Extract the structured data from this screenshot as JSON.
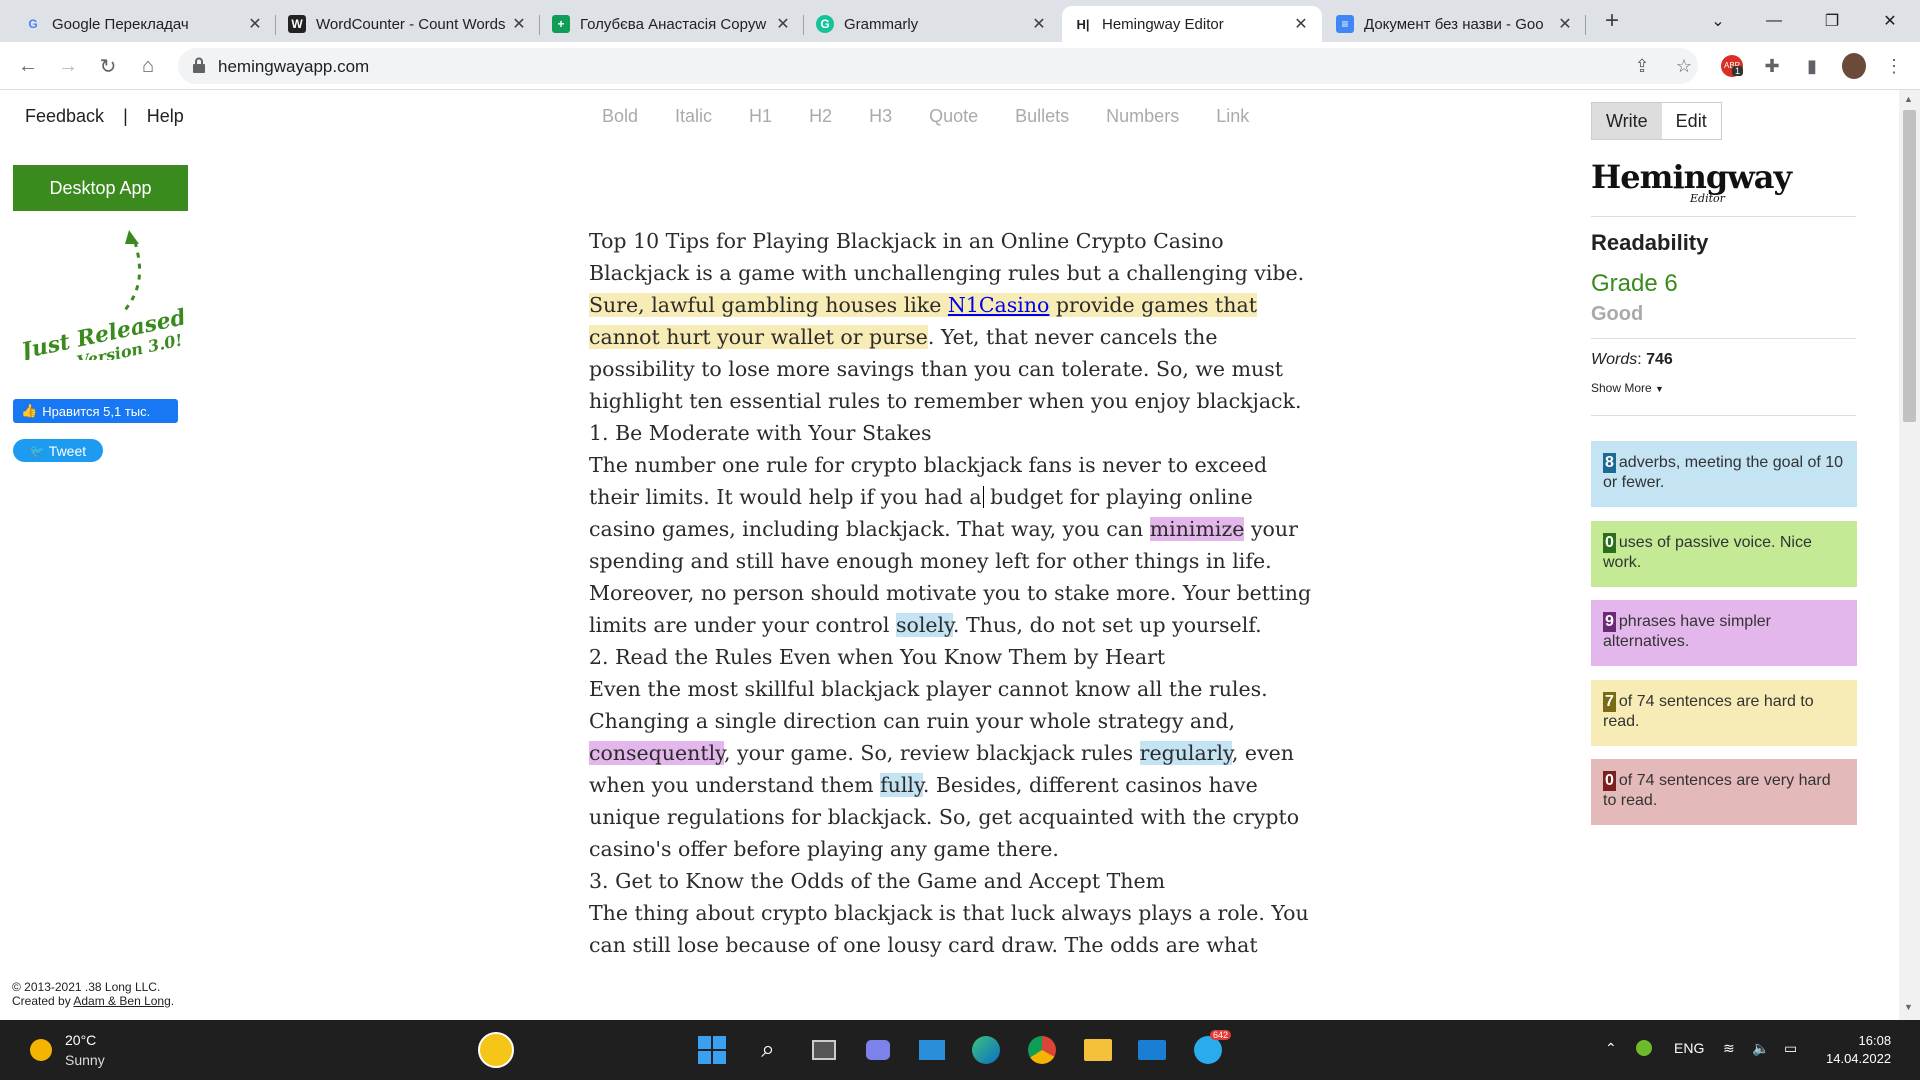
{
  "browser": {
    "tabs": [
      {
        "title": "Google Перекладач",
        "favicon": "G",
        "color": "#4285f4"
      },
      {
        "title": "WordCounter - Count Words",
        "favicon": "W",
        "color": "#222"
      },
      {
        "title": "Голубєва Анастасія Copyw",
        "favicon": "+",
        "color": "#0f9d58"
      },
      {
        "title": "Grammarly",
        "favicon": "G",
        "color": "#15c39a"
      },
      {
        "title": "Hemingway Editor",
        "favicon": "H|",
        "color": "#222"
      },
      {
        "title": "Документ без назви - Goo",
        "favicon": "≡",
        "color": "#4285f4"
      }
    ],
    "url": "hemingwayapp.com",
    "extension_badge": "1"
  },
  "sidebar": {
    "feedback": "Feedback",
    "separator": "|",
    "help": "Help",
    "desktop_app": "Desktop App",
    "promo_line1": "Just Released!",
    "promo_line2": "Version 3.0!",
    "fb_like": "Нравится 5,1 тыс.",
    "tweet": "Tweet",
    "copyright_line1": "© 2013-2021 .38 Long LLC.",
    "copyright_line2_prefix": "Created by ",
    "copyright_authors": "Adam & Ben Long",
    "copyright_suffix": "."
  },
  "format_bar": [
    "Bold",
    "Italic",
    "H1",
    "H2",
    "H3",
    "Quote",
    "Bullets",
    "Numbers",
    "Link"
  ],
  "editor": {
    "title": "Top 10 Tips for Playing Blackjack in an Online Crypto Casino",
    "p1_a": "Blackjack is a game with unchallenging rules but a challenging vibe.",
    "p1_hard_a": "Sure, lawful gambling houses like ",
    "p1_link": "N1Casino",
    "p1_hard_b": " provide games that cannot hurt your wallet or purse",
    "p1_b": ". Yet, that never cancels the possibility to lose more savings than you can tolerate. So, we must highlight ten essential rules to remember when you enjoy blackjack.",
    "h1": "1. Be Moderate with Your Stakes",
    "p2_a": "The number one rule for crypto blackjack fans is never to exceed their limits. It would help if you had a",
    "p2_b": " budget for playing online casino games, including blackjack. That way, you can ",
    "p2_simple": "minimize",
    "p2_c": " your spending and still have enough money left for other things in life.",
    "p3_a": "Moreover, no person should motivate you to stake more. Your betting limits are under your control ",
    "p3_adv": "solely",
    "p3_b": ". Thus, do not set up yourself.",
    "h2": "2. Read the Rules Even when You Know Them by Heart",
    "p4_a": "Even the most skillful blackjack player cannot know all the rules. Changing a single direction can ruin your whole strategy and, ",
    "p4_simple": "consequently",
    "p4_b": ", your game. So, review blackjack rules ",
    "p4_adv1": "regularly",
    "p4_c": ", even when you understand them ",
    "p4_adv2": "fully",
    "p4_d": ". Besides, different casinos have unique regulations for blackjack. So, get acquainted with the crypto casino's offer before playing any game there.",
    "h3": "3. Get to Know the Odds of the Game and Accept Them",
    "p5": "The thing about crypto blackjack is that luck always plays a role. You can still lose because of one lousy card draw. The odds are what"
  },
  "panel": {
    "write": "Write",
    "edit": "Edit",
    "logo": "Hemingway",
    "logo_sub": "Editor",
    "readability": "Readability",
    "grade": "Grade 6",
    "grade_label": "Good",
    "words_label": "Words",
    "words_value": "746",
    "show_more": "Show More",
    "stats": [
      {
        "num": "8",
        "text": "adverbs, meeting the goal of 10 or fewer.",
        "bg": "#c4e3f3",
        "numbg": "#1c6a94"
      },
      {
        "num": "0",
        "text": "uses of passive voice. Nice work.",
        "bg": "#c4ea95",
        "numbg": "#2d6e1a"
      },
      {
        "num": "9",
        "text": "phrases have simpler alternatives.",
        "bg": "#e3b7eb",
        "numbg": "#6b2a78"
      },
      {
        "num": "7",
        "text": "of 74 sentences are hard to read.",
        "bg": "#f7ecb5",
        "numbg": "#7a6a14"
      },
      {
        "num": "0",
        "text": "of 74 sentences are very hard to read.",
        "bg": "#e4b9b9",
        "numbg": "#7a2020"
      }
    ]
  },
  "taskbar": {
    "temp": "20°C",
    "weather": "Sunny",
    "lang": "ENG",
    "time": "16:08",
    "date": "14.04.2022",
    "telegram_badge": "642"
  }
}
